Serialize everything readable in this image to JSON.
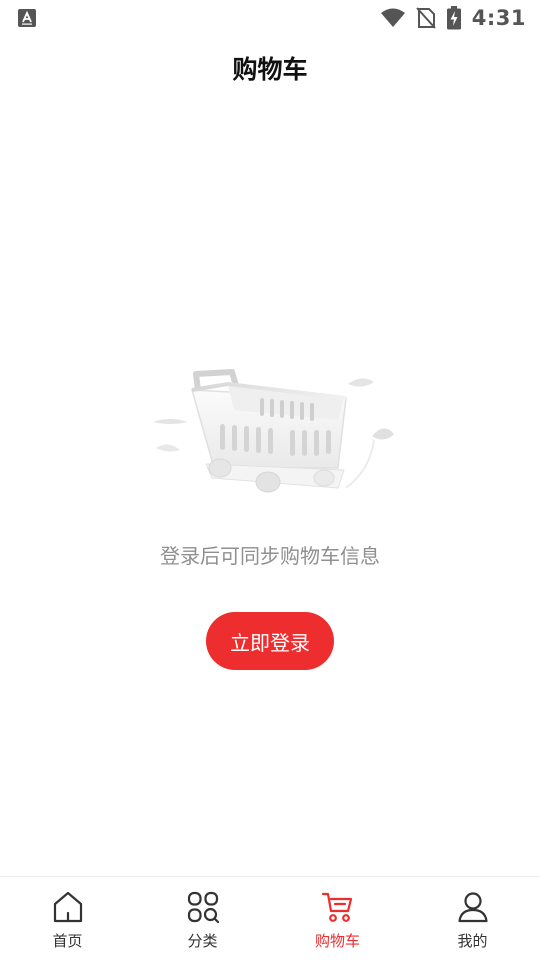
{
  "status_bar": {
    "time": "4:31",
    "icons": [
      "keyboard-a-icon",
      "wifi-icon",
      "no-sim-icon",
      "battery-charging-icon"
    ]
  },
  "header": {
    "title": "购物车"
  },
  "empty_state": {
    "illustration": "empty-cart-illustration",
    "message": "登录后可同步购物车信息",
    "login_button_label": "立即登录"
  },
  "bottom_nav": {
    "active_index": 2,
    "active_color": "#ee2d2e",
    "items": [
      {
        "label": "首页",
        "icon": "home-icon"
      },
      {
        "label": "分类",
        "icon": "category-icon"
      },
      {
        "label": "购物车",
        "icon": "cart-icon"
      },
      {
        "label": "我的",
        "icon": "profile-icon"
      }
    ]
  }
}
